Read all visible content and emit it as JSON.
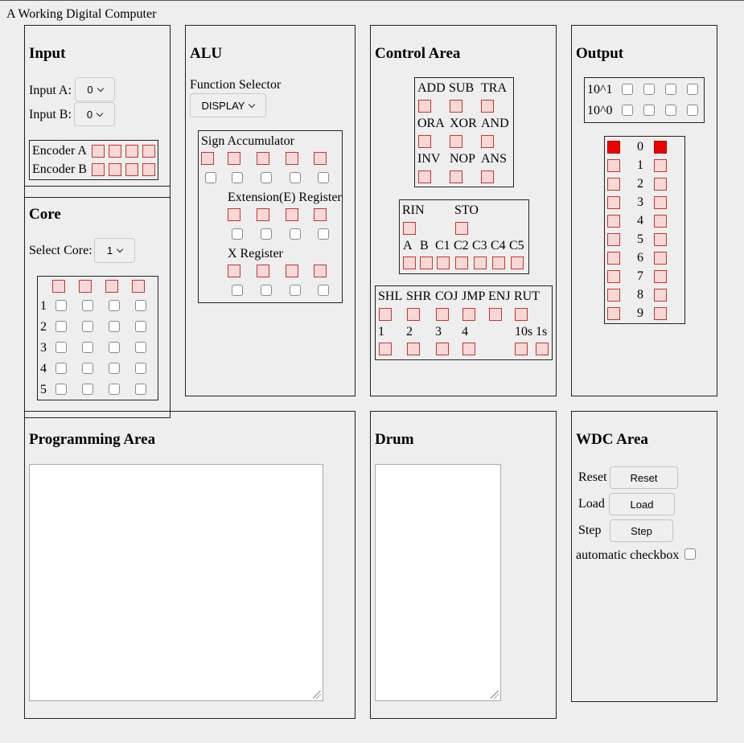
{
  "app": {
    "title": "A Working Digital Computer"
  },
  "input": {
    "heading": "Input",
    "input_a_label": "Input A:",
    "input_a_value": "0",
    "input_b_label": "Input B:",
    "input_b_value": "0",
    "encoder_a_label": "Encoder A",
    "encoder_b_label": "Encoder B"
  },
  "core": {
    "heading": "Core",
    "select_label": "Select Core:",
    "select_value": "1",
    "rows": [
      "1",
      "2",
      "3",
      "4",
      "5"
    ]
  },
  "alu": {
    "heading": "ALU",
    "function_selector_label": "Function Selector",
    "function_value": "DISPLAY",
    "sign_accumulator_label": "Sign Accumulator",
    "extension_register_label": "Extension(E) Register",
    "x_register_label": "X Register"
  },
  "control": {
    "heading": "Control Area",
    "ops": [
      "ADD",
      "SUB",
      "TRA",
      "ORA",
      "XOR",
      "AND",
      "INV",
      "NOP",
      "ANS"
    ],
    "rin_label": "RIN",
    "sto_label": "STO",
    "regs": [
      "A",
      "B",
      "C1",
      "C2",
      "C3",
      "C4",
      "C5"
    ],
    "shift_ops": [
      "SHL",
      "SHR",
      "COJ",
      "JMP",
      "ENJ",
      "RUT"
    ],
    "step_labels": [
      "1",
      "2",
      "3",
      "4"
    ],
    "timer_labels": [
      "10s",
      "1s"
    ]
  },
  "output": {
    "heading": "Output",
    "row_labels": [
      "10^1",
      "10^0"
    ],
    "digits": [
      "0",
      "1",
      "2",
      "3",
      "4",
      "5",
      "6",
      "7",
      "8",
      "9"
    ],
    "lit_digit": "0"
  },
  "programming": {
    "heading": "Programming Area",
    "value": ""
  },
  "drum": {
    "heading": "Drum",
    "value": ""
  },
  "wdc": {
    "heading": "WDC Area",
    "reset_label": "Reset",
    "reset_button": "Reset",
    "load_label": "Load",
    "load_button": "Load",
    "step_label": "Step",
    "step_button": "Step",
    "automatic_label": "automatic checkbox"
  },
  "colors": {
    "lamp_off": "#f8d7d7",
    "lamp_on": "#ee0000",
    "lamp_border": "#c0392b",
    "background": "#eeeeee"
  }
}
